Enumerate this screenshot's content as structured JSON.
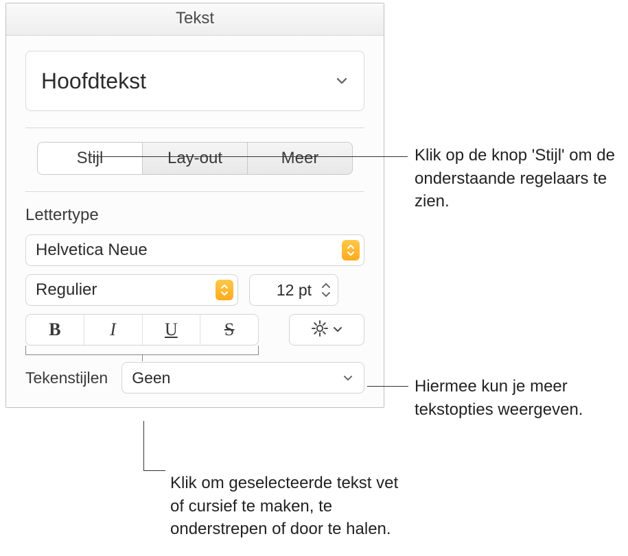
{
  "panel": {
    "title": "Tekst"
  },
  "paragraph_style": {
    "selected": "Hoofdtekst"
  },
  "tabs": {
    "items": [
      {
        "label": "Stijl",
        "active": true
      },
      {
        "label": "Lay-out",
        "active": false
      },
      {
        "label": "Meer",
        "active": false
      }
    ]
  },
  "font": {
    "section_label": "Lettertype",
    "family": "Helvetica Neue",
    "weight": "Regulier",
    "size": "12 pt",
    "bold_glyph": "B",
    "italic_glyph": "I",
    "underline_glyph": "U",
    "strike_glyph": "S"
  },
  "character_styles": {
    "label": "Tekenstijlen",
    "selected": "Geen"
  },
  "callouts": {
    "c1": "Klik op de knop 'Stijl' om de onderstaande regelaars te zien.",
    "c2": "Hiermee kun je meer tekstopties weergeven.",
    "c3": "Klik om geselecteerde tekst vet of cursief te maken, te onderstrepen of door te halen."
  }
}
